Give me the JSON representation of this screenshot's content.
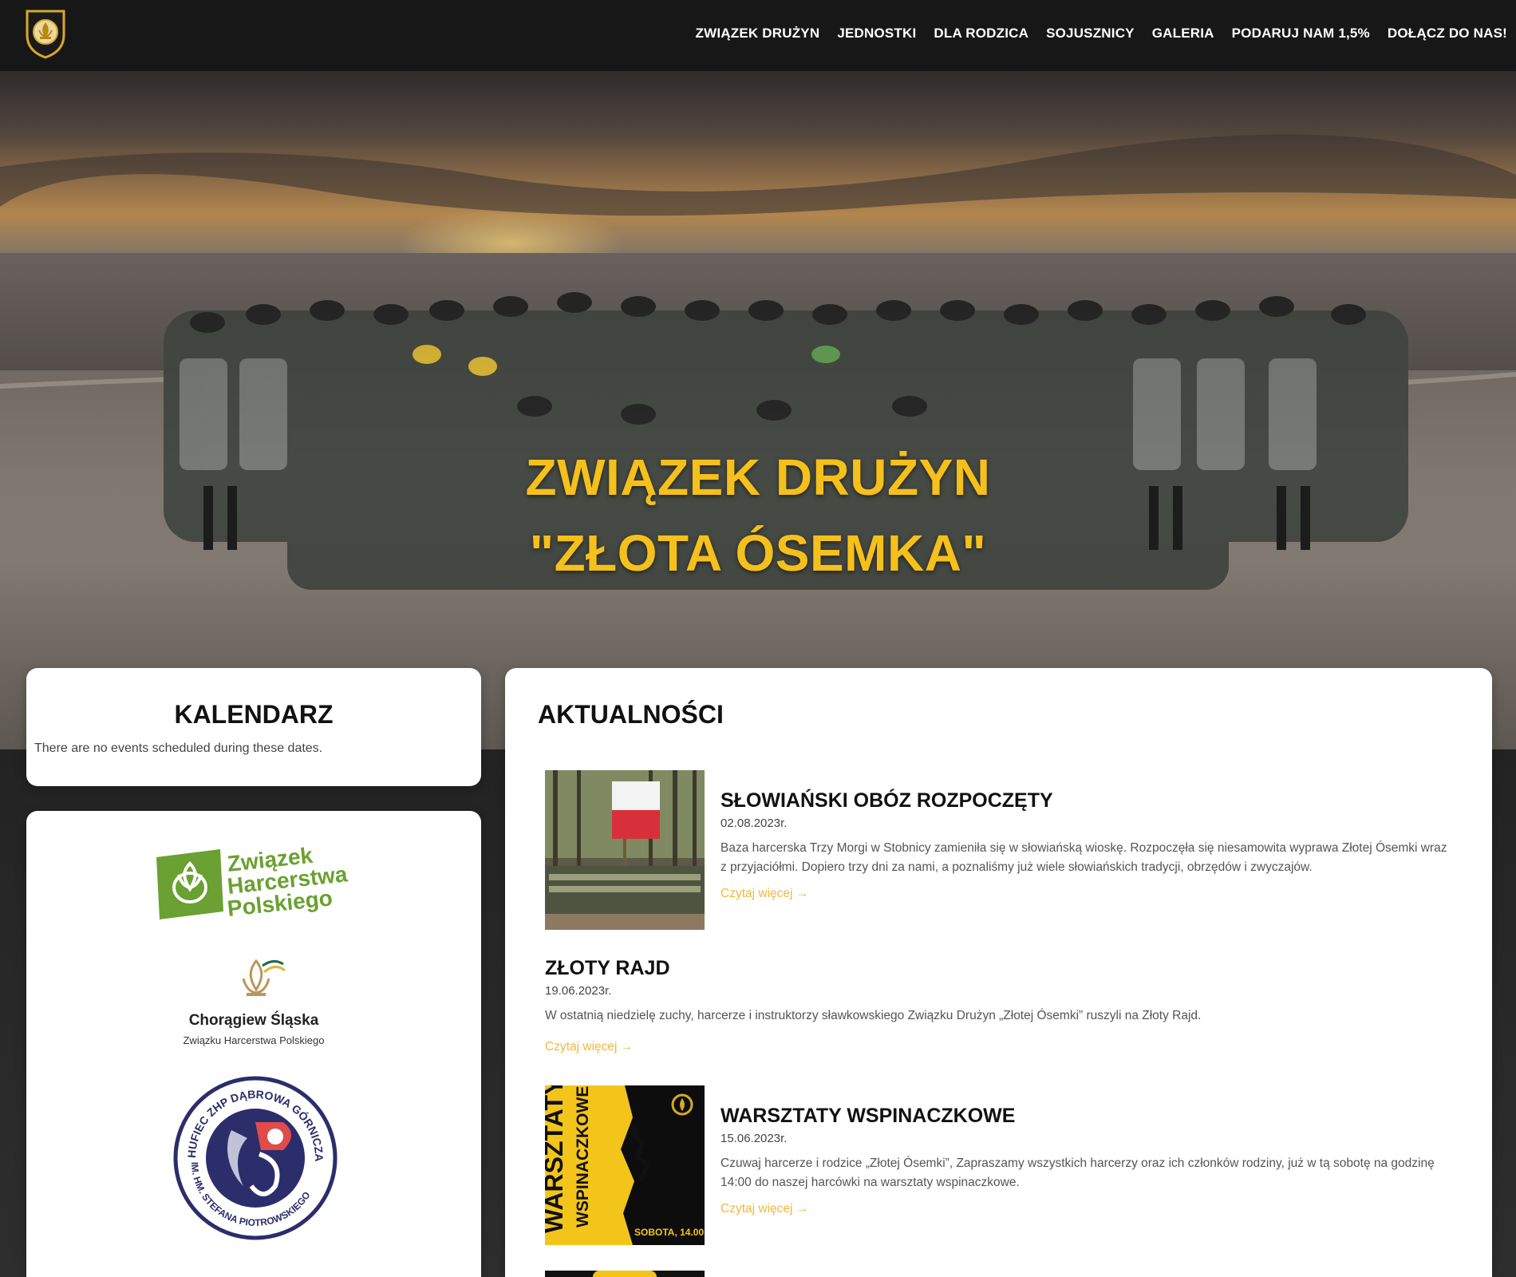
{
  "nav": {
    "items": [
      {
        "label": "ZWIĄZEK DRUŻYN"
      },
      {
        "label": "JEDNOSTKI"
      },
      {
        "label": "DLA RODZICA"
      },
      {
        "label": "SOJUSZNICY"
      },
      {
        "label": "GALERIA"
      },
      {
        "label": "PODARUJ NAM 1,5%"
      },
      {
        "label": "DOŁĄCZ DO NAS!"
      }
    ]
  },
  "hero": {
    "title_line1": "ZWIĄZEK DRUŻYN",
    "title_line2": "\"ZŁOTA ÓSEMKA\""
  },
  "calendar": {
    "title": "KALENDARZ",
    "empty_text": "There are no events scheduled during these dates."
  },
  "partners": {
    "zhp": {
      "line1": "Związek",
      "line2": "Harcerstwa",
      "line3": "Polskiego"
    },
    "choragiew": {
      "name": "Chorągiew Śląska",
      "sub": "Związku Harcerstwa Polskiego"
    },
    "hufiec": {
      "ring_top": "HUFIEC ZHP DĄBROWA GÓRNICZA",
      "ring_bottom": "IM. HM. STEFANA PIOTROWSKIEGO"
    }
  },
  "news": {
    "title": "AKTUALNOŚCI",
    "posts": [
      {
        "title": "SŁOWIAŃSKI OBÓZ ROZPOCZĘTY",
        "date": "02.08.2023r.",
        "excerpt": "Baza harcerska Trzy Morgi w Stobnicy zamieniła się w słowiańską wioskę. Rozpoczęła się niesamowita wyprawa Złotej Ósemki wraz z przyjaciółmi. Dopiero trzy dni za nami, a poznaliśmy już wiele słowiańskich tradycji, obrzędów i zwyczajów.",
        "more": "Czytaj więcej →"
      },
      {
        "title": "ZŁOTY RAJD",
        "date": "19.06.2023r.",
        "excerpt": "W ostatnią niedzielę zuchy, harcerze i instruktorzy sławkowskiego Związku Drużyn „Złotej Ósemki” ruszyli na Złoty Rajd.",
        "more": "Czytaj więcej →"
      },
      {
        "title": "WARSZTATY WSPINACZKOWE",
        "date": "15.06.2023r.",
        "excerpt": "Czuwaj harcerze i rodzice „Złotej Ósemki”, Zapraszamy wszystkich harcerzy oraz ich członków rodziny, już w tą sobotę na godzinę 14:00 do naszej harcówki na warsztaty wspinaczkowe.",
        "more": "Czytaj więcej →",
        "poster_title_1": "WARSZTATY",
        "poster_title_2": "WSPINACZKOWE",
        "poster_time": "SOBOTA, 14.00"
      }
    ]
  },
  "colors": {
    "accent": "#f6c01b",
    "link": "#f0b83a",
    "zhp_green": "#6aa132",
    "nav_bg": "#171717"
  }
}
